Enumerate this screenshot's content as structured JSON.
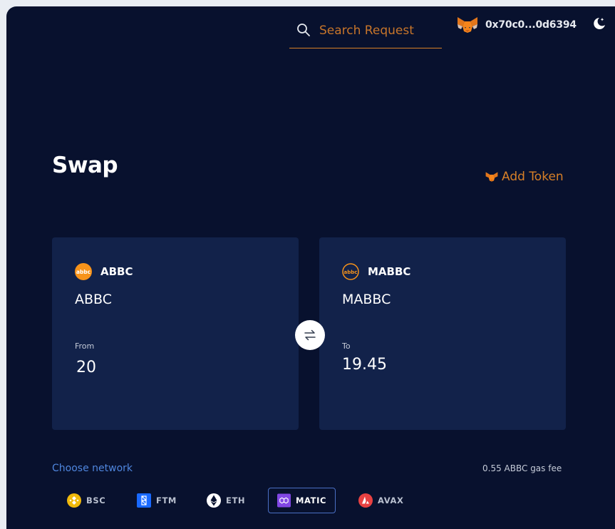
{
  "header": {
    "search_placeholder": "Search Request",
    "wallet_address": "0x70c0...0d6394"
  },
  "main": {
    "title": "Swap",
    "add_token_label": "Add Token"
  },
  "from_card": {
    "symbol": "ABBC",
    "name": "ABBC",
    "amount_label": "From",
    "amount": "20"
  },
  "to_card": {
    "symbol": "MABBC",
    "name": "MABBC",
    "amount_label": "To",
    "amount": "19.45"
  },
  "footer": {
    "choose_network_label": "Choose network",
    "gas_fee": "0.55 ABBC gas fee"
  },
  "networks": [
    {
      "label": "BSC",
      "icon": "bsc-icon",
      "color": "#f0b90b"
    },
    {
      "label": "FTM",
      "icon": "fantom-icon",
      "color": "#1969ff"
    },
    {
      "label": "ETH",
      "icon": "ethereum-icon",
      "color": "#ffffff"
    },
    {
      "label": "MATIC",
      "icon": "polygon-icon",
      "color": "#8247e5",
      "selected": true
    },
    {
      "label": "AVAX",
      "icon": "avalanche-icon",
      "color": "#e84142"
    }
  ],
  "colors": {
    "background": "#08112e",
    "card": "#12224a",
    "accent": "#d77f27",
    "link": "#4f86de",
    "selected_border": "#4a6fc4"
  }
}
